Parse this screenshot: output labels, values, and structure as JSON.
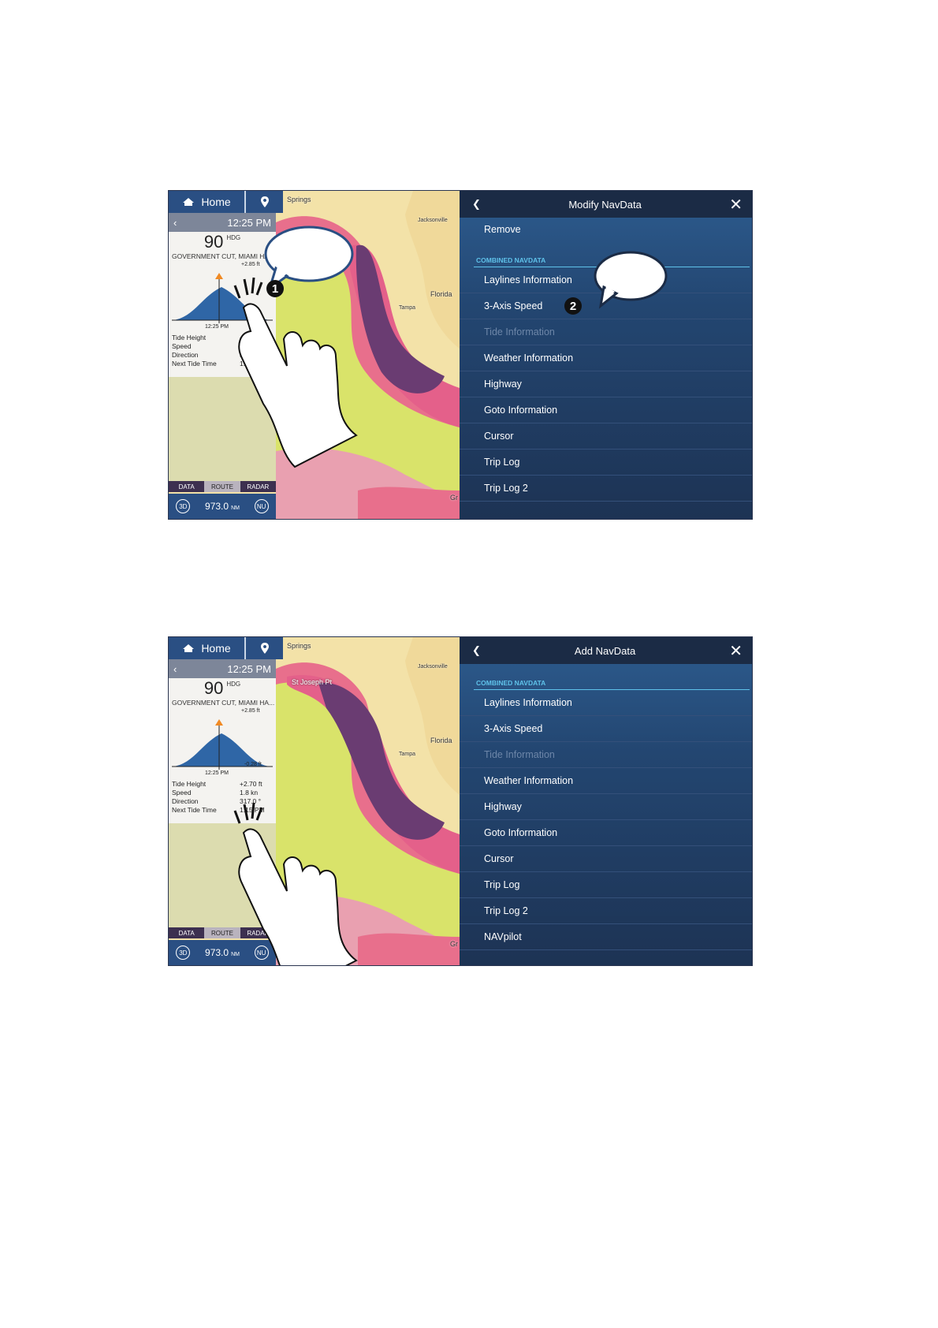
{
  "common": {
    "nav": {
      "home_label": "Home"
    },
    "map_labels": {
      "springs": "Springs",
      "jacksonville": "Jacksonville",
      "tampa": "Tampa",
      "florida": "Florida",
      "edge": "Gr"
    },
    "panel": {
      "time": "12:25 PM",
      "heading_value": "90",
      "heading_unit": "HDG",
      "station": "GOVERNMENT CUT, MIAMI HA...",
      "chart_high": "+2.85 ft",
      "chart_low": "-0.28 ft",
      "chart_time": "12:25 PM",
      "rows": [
        {
          "label": "Tide Height",
          "value": "+2.70 ft"
        },
        {
          "label": "Speed",
          "value": "1.8 kn"
        },
        {
          "label": "Direction",
          "value": "317.0 °"
        },
        {
          "label": "Next Tide Time",
          "value": "1:15 PM"
        }
      ]
    },
    "tabs": [
      "DATA",
      "ROUTE",
      "RADAR"
    ],
    "status": {
      "mode": "3D",
      "distance": "973.0",
      "unit": "NM",
      "orientation": "NU"
    },
    "combined_label": "COMBINED NAVDATA",
    "colors": {
      "dialog_top": "#2d5c8f",
      "dialog_bottom": "#1d3354",
      "section_accent": "#5fc2ea",
      "nav_bar": "#2a4f83"
    }
  },
  "shot1": {
    "title": "Modify NavData",
    "remove_label": "Remove",
    "items": [
      "Laylines Information",
      "3-Axis Speed",
      "Tide Information",
      "Weather Information",
      "Highway",
      "Goto Information",
      "Cursor",
      "Trip Log",
      "Trip Log 2"
    ],
    "callouts": [
      "1",
      "2"
    ]
  },
  "shot2": {
    "title": "Add NavData",
    "map_extra_label": "St Joseph Pt",
    "items": [
      "Laylines Information",
      "3-Axis Speed",
      "Tide Information",
      "Weather Information",
      "Highway",
      "Goto Information",
      "Cursor",
      "Trip Log",
      "Trip Log 2",
      "NAVpilot"
    ]
  }
}
